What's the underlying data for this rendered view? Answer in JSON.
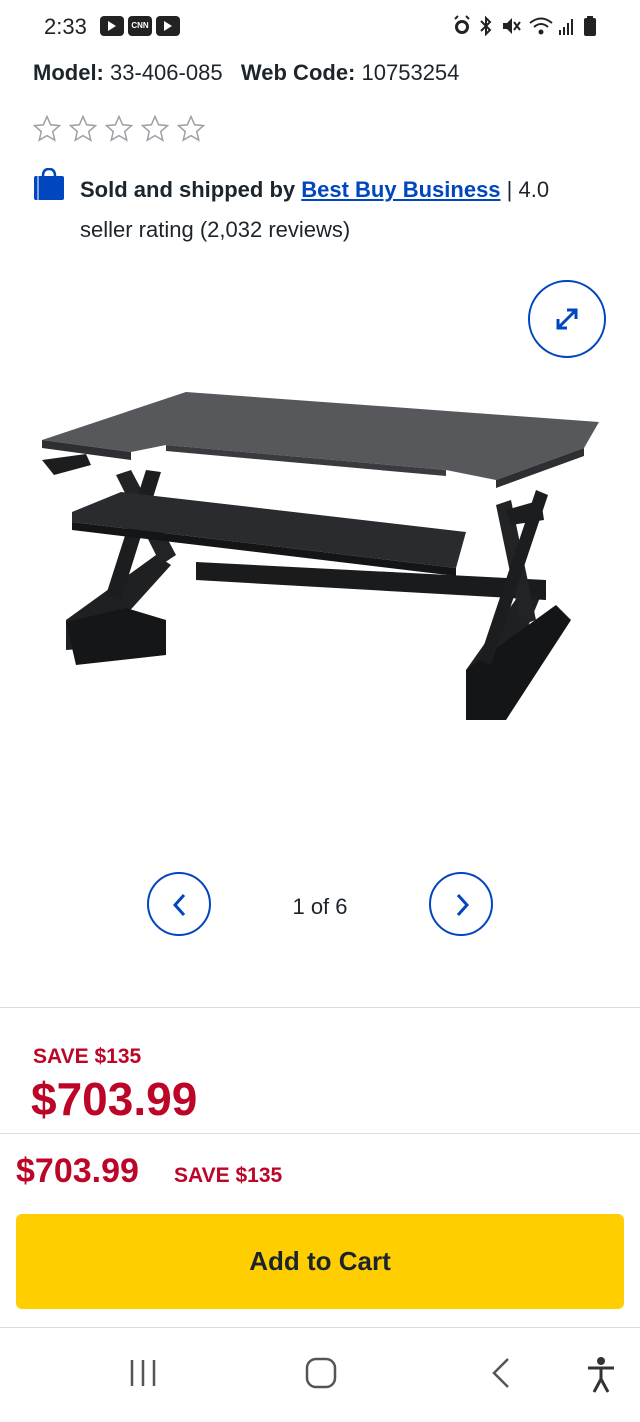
{
  "status_bar": {
    "time": "2:33",
    "app_icons": [
      "youtube-icon",
      "cnn-icon",
      "youtube-icon"
    ],
    "cnn_label": "CNN",
    "system_icons": [
      "alarm-icon",
      "bluetooth-icon",
      "mute-icon",
      "wifi-icon",
      "signal-icon",
      "battery-icon"
    ]
  },
  "product": {
    "model_label": "Model:",
    "model_value": "33-406-085",
    "webcode_label": "Web Code:",
    "webcode_value": "10753254",
    "rating_stars_filled": 0,
    "rating_stars_total": 5
  },
  "seller": {
    "prefix": "Sold and shipped by",
    "name": "Best Buy Business",
    "suffix": "| 4.0 seller rating (2,032 reviews)"
  },
  "gallery": {
    "count_text": "1 of 6"
  },
  "pricing": {
    "save_label": "SAVE $135",
    "price": "$703.99"
  },
  "sticky_bar": {
    "price": "$703.99",
    "save_label": "SAVE $135",
    "add_to_cart_label": "Add to Cart"
  },
  "colors": {
    "accent_blue": "#0046be",
    "sale_red": "#bb0628",
    "cart_yellow": "#ffce00"
  }
}
